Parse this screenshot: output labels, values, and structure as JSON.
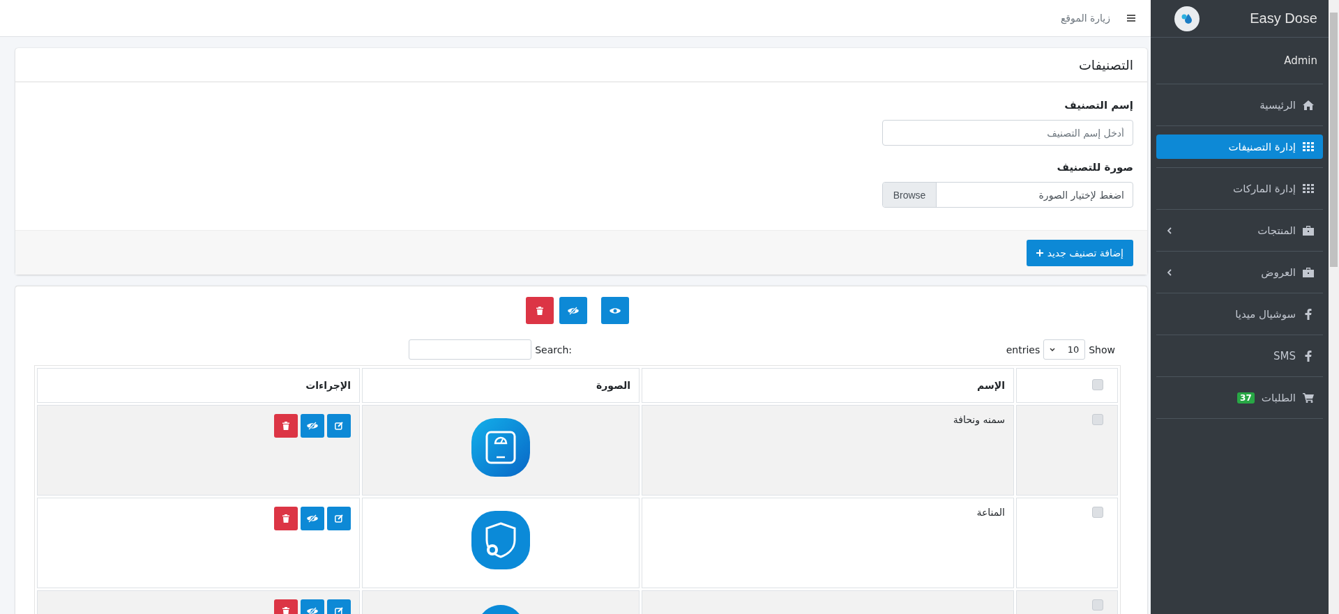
{
  "navbar": {
    "link": "زيارة الموقع"
  },
  "sidebar": {
    "brand": "Easy Dose",
    "user": "Admin",
    "items": [
      {
        "label": "الرئيسية",
        "kind": "home",
        "selected": false,
        "expandable": false
      },
      {
        "label": "إدارة التصنيفات",
        "kind": "grid",
        "selected": true,
        "expandable": false
      },
      {
        "label": "إدارة الماركات",
        "kind": "grid",
        "selected": false,
        "expandable": false
      },
      {
        "label": "المنتجات",
        "kind": "briefcase",
        "selected": false,
        "expandable": true
      },
      {
        "label": "العروض",
        "kind": "briefcase",
        "selected": false,
        "expandable": true
      },
      {
        "label": "سوشيال ميديا",
        "kind": "facebook",
        "selected": false,
        "expandable": false
      },
      {
        "label": "SMS",
        "kind": "facebook",
        "selected": false,
        "expandable": false
      },
      {
        "label": "الطلبات",
        "kind": "cart",
        "selected": false,
        "expandable": false,
        "badge": "37"
      }
    ]
  },
  "form_card": {
    "title": "التصنيفات",
    "fields": [
      {
        "label": "إسم التصنيف",
        "kind": "text",
        "placeholder": "أدخل إسم التصنيف"
      },
      {
        "label": "صورة للتصنيف",
        "kind": "file",
        "placeholder": "اضغط لإختيار الصورة",
        "button": "Browse"
      }
    ],
    "submit": "إضافة تصنيف جديد"
  },
  "list": {
    "bulk_actions": [
      {
        "kind": "show"
      },
      {
        "kind": "hide"
      },
      {
        "kind": "delete"
      }
    ],
    "length": {
      "before": "Show",
      "value": "10",
      "after": "entries"
    },
    "search": {
      "label": "Search:"
    },
    "table": {
      "select_all": {
        "checked": false
      },
      "columns": [
        "الإسم",
        "الصورة",
        "الإجراءات"
      ],
      "rows": [
        {
          "checked": false,
          "name": "سمنه ونحافة",
          "kind": "scale"
        },
        {
          "checked": false,
          "name": "المناعة",
          "kind": "shield"
        },
        {
          "checked": false,
          "kind": "other"
        }
      ]
    }
  }
}
